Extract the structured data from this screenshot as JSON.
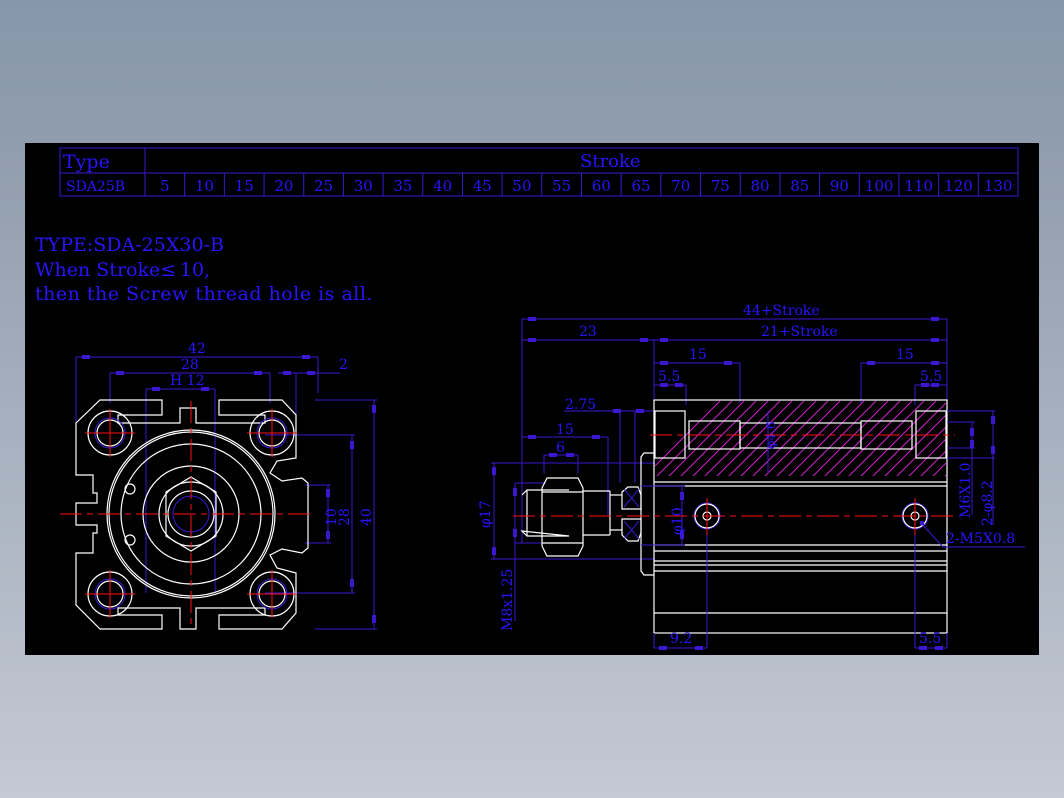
{
  "table": {
    "type_header": "Type",
    "stroke_header": "Stroke",
    "model": "SDA25B",
    "strokes": [
      "5",
      "10",
      "15",
      "20",
      "25",
      "30",
      "35",
      "40",
      "45",
      "50",
      "55",
      "60",
      "65",
      "70",
      "75",
      "80",
      "85",
      "90",
      "100",
      "110",
      "120",
      "130"
    ]
  },
  "notes": {
    "line1": "TYPE:SDA-25X30-B",
    "line2": "When Stroke≤ 10,",
    "line3": "then the Screw thread hole is all."
  },
  "front_view": {
    "dim_42": "42",
    "dim_28": "28",
    "dim_h12": "H 12",
    "dim_2": "2",
    "dim_10": "10",
    "dim_28v": "28",
    "dim_40": "40"
  },
  "side_view": {
    "dim_total": "44+Stroke",
    "dim_23": "23",
    "dim_body": "21+Stroke",
    "dim_15_left": "15",
    "dim_15_right": "15",
    "dim_5_5_left": "5.5",
    "dim_5_5_right": "5.5",
    "dim_2_75": "2.75",
    "dim_rod_15": "15",
    "dim_6": "6",
    "dim_phi17": "φ17",
    "dim_phi10": "φ10",
    "dim_phi4_6": "φ4.6",
    "thread_rod": "M8x1.25",
    "thread_m6": "M6X1.0",
    "counterbore": "2-φ8.2",
    "port_thread": "2-M5X0.8",
    "dim_9_2": "9.2",
    "dim_5_5_bottom": "5.5"
  },
  "colors": {
    "text": "#2a14ff",
    "dimension": "#3b18d0",
    "outline": "#ffffff",
    "centerline": "#ff1010",
    "hatch": "#d020d0",
    "background": "#000000"
  }
}
